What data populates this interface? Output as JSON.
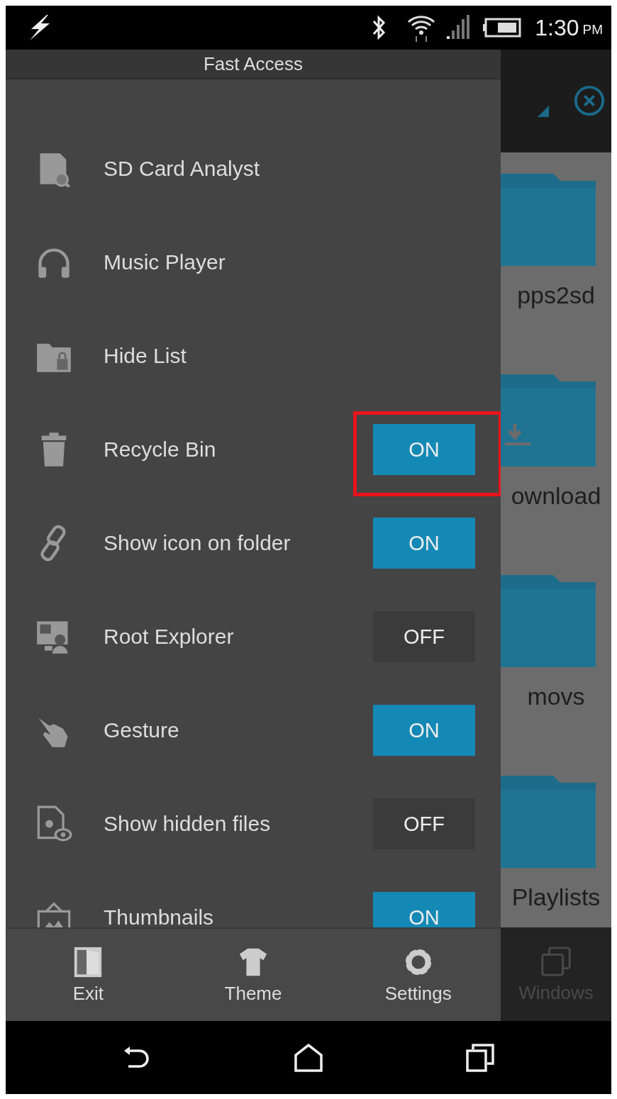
{
  "status_bar": {
    "time": "1:30",
    "period": "PM"
  },
  "drawer": {
    "title": "Fast Access",
    "items": [
      {
        "label": "SD Card Analyst",
        "kind": "link"
      },
      {
        "label": "Music Player",
        "kind": "link"
      },
      {
        "label": "Hide List",
        "kind": "link"
      },
      {
        "label": "Recycle Bin",
        "kind": "toggle",
        "on": true,
        "state_text": "ON",
        "highlighted": true
      },
      {
        "label": "Show icon on folder",
        "kind": "toggle",
        "on": true,
        "state_text": "ON",
        "highlighted": false
      },
      {
        "label": "Root Explorer",
        "kind": "toggle",
        "on": false,
        "state_text": "OFF",
        "highlighted": false
      },
      {
        "label": "Gesture",
        "kind": "toggle",
        "on": true,
        "state_text": "ON",
        "highlighted": false
      },
      {
        "label": "Show hidden files",
        "kind": "toggle",
        "on": false,
        "state_text": "OFF",
        "highlighted": false
      },
      {
        "label": "Thumbnails",
        "kind": "toggle",
        "on": true,
        "state_text": "ON",
        "highlighted": false
      }
    ],
    "toolbar": [
      {
        "label": "Exit"
      },
      {
        "label": "Theme"
      },
      {
        "label": "Settings"
      }
    ]
  },
  "file_pane": {
    "folders": [
      {
        "name": "pps2sd"
      },
      {
        "name": "ownload"
      },
      {
        "name": "movs"
      },
      {
        "name": "Playlists"
      }
    ],
    "toolbar_item": {
      "label": "Windows",
      "disabled": true
    }
  }
}
